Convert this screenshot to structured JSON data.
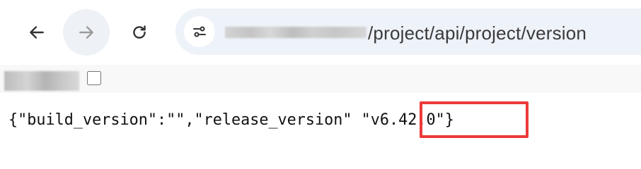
{
  "browser": {
    "icons": {
      "back": "arrow-left-icon",
      "forward": "arrow-right-icon",
      "reload": "reload-icon",
      "site_info": "tune-icon"
    },
    "address_bar": {
      "url_path": "/project/api/project/version"
    }
  },
  "page": {
    "json_text": "{\"build_version\":\"\",\"release_version\" \"v6.42.0\"}"
  },
  "colors": {
    "highlight_border": "#ec3a3a",
    "omnibox_bg": "#eef2f9"
  }
}
